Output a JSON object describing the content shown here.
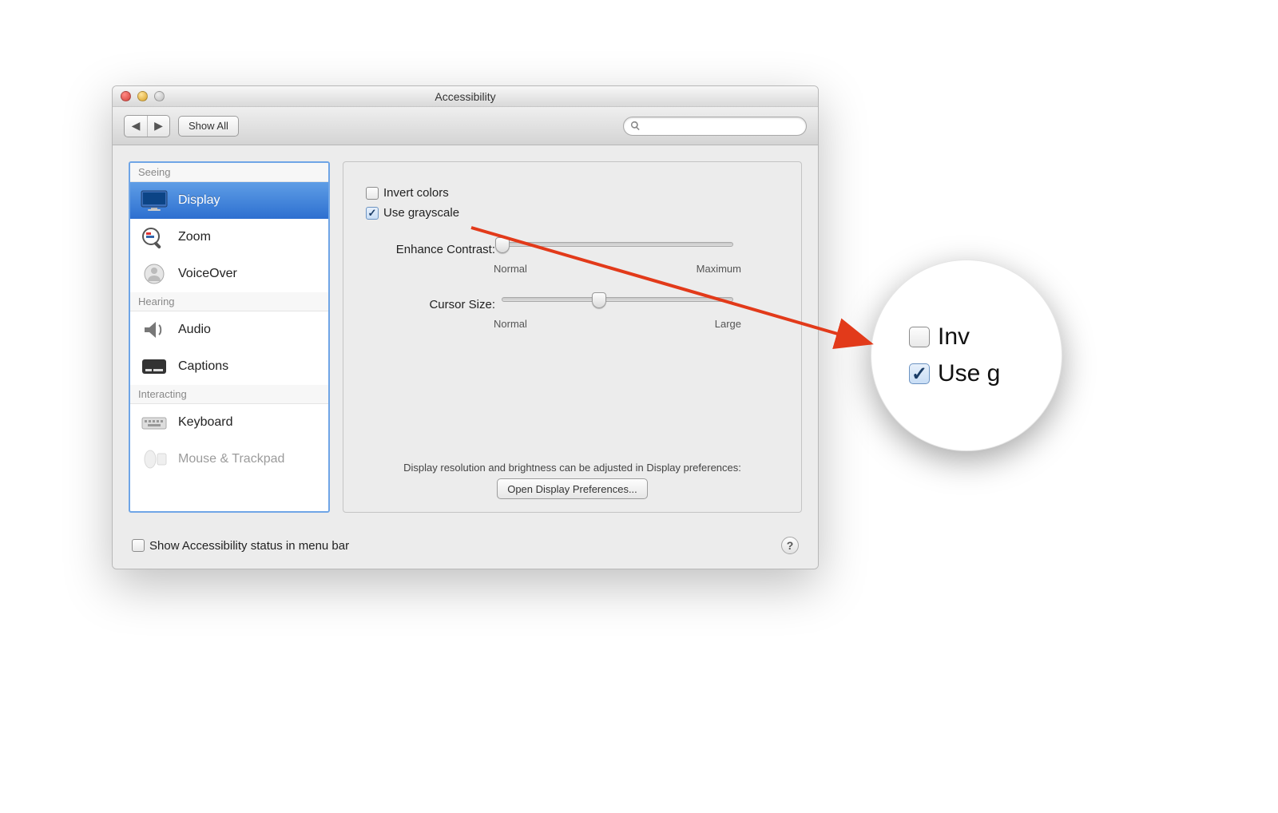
{
  "window_title": "Accessibility",
  "toolbar": {
    "show_all_label": "Show All",
    "search_placeholder": ""
  },
  "sidebar": {
    "groups": [
      {
        "label": "Seeing",
        "items": [
          {
            "name": "Display",
            "icon": "display-icon",
            "selected": true
          },
          {
            "name": "Zoom",
            "icon": "zoom-icon"
          },
          {
            "name": "VoiceOver",
            "icon": "voiceover-icon"
          }
        ]
      },
      {
        "label": "Hearing",
        "items": [
          {
            "name": "Audio",
            "icon": "audio-icon"
          },
          {
            "name": "Captions",
            "icon": "captions-icon"
          }
        ]
      },
      {
        "label": "Interacting",
        "items": [
          {
            "name": "Keyboard",
            "icon": "keyboard-icon"
          },
          {
            "name": "Mouse & Trackpad",
            "icon": "mouse-trackpad-icon"
          }
        ]
      }
    ]
  },
  "content": {
    "invert_colors": {
      "label": "Invert colors",
      "checked": false
    },
    "use_grayscale": {
      "label": "Use grayscale",
      "checked": true
    },
    "enhance_contrast": {
      "label": "Enhance Contrast:",
      "min_label": "Normal",
      "max_label": "Maximum",
      "value_percent": 0
    },
    "cursor_size": {
      "label": "Cursor Size:",
      "min_label": "Normal",
      "max_label": "Large",
      "value_percent": 42
    },
    "hint_text": "Display resolution and brightness can be adjusted in Display preferences:",
    "open_prefs_label": "Open Display Preferences..."
  },
  "bottom": {
    "status_in_menu_bar": {
      "label": "Show Accessibility status in menu bar",
      "checked": false
    }
  },
  "magnifier": {
    "row1_label": "Inv",
    "row2_label": "Use g"
  }
}
